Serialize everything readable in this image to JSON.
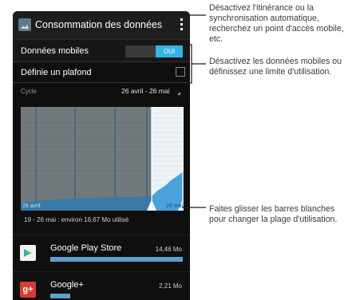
{
  "app_bar": {
    "title": "Consommation des données",
    "overflow_icon": "overflow-menu-icon"
  },
  "mobile_data": {
    "label": "Données mobiles",
    "toggle_state": "OUI"
  },
  "limit": {
    "label": "Définie un plafond",
    "checked": false
  },
  "cycle": {
    "label": "Cycle",
    "value": "26 avril - 26 mai"
  },
  "chart": {
    "start_label": "26 avril",
    "end_label": "26 mai",
    "summary": "19 - 26 mai : environ 16,67 Mo utilisé"
  },
  "apps": [
    {
      "name": "Google Play Store",
      "size": "14,46 Mo",
      "icon": "google-play-store-icon",
      "usage_fraction": 1.0
    },
    {
      "name": "Google+",
      "size": "2,21 Mo",
      "icon": "google-plus-icon",
      "logo_text": "g+",
      "usage_fraction": 0.153
    }
  ],
  "callouts": {
    "menu": "Désactivez l'itinérance ou la synchronisation automatique, recherchez un point d'accès mobile, etc.",
    "data": "Désactivez les données mobiles ou définissez une limite d'utilisation.",
    "range": "Faites glisser les barres blanches pour changer la plage d'utilisation."
  },
  "colors": {
    "accent": "#33b5e5",
    "bar": "#5aa1d0",
    "callout_line": "#1a1a1a"
  },
  "chart_data": {
    "type": "area",
    "x": [
      "26 avril",
      "26 mai"
    ],
    "title": "",
    "xlabel": "",
    "ylabel": ""
  }
}
